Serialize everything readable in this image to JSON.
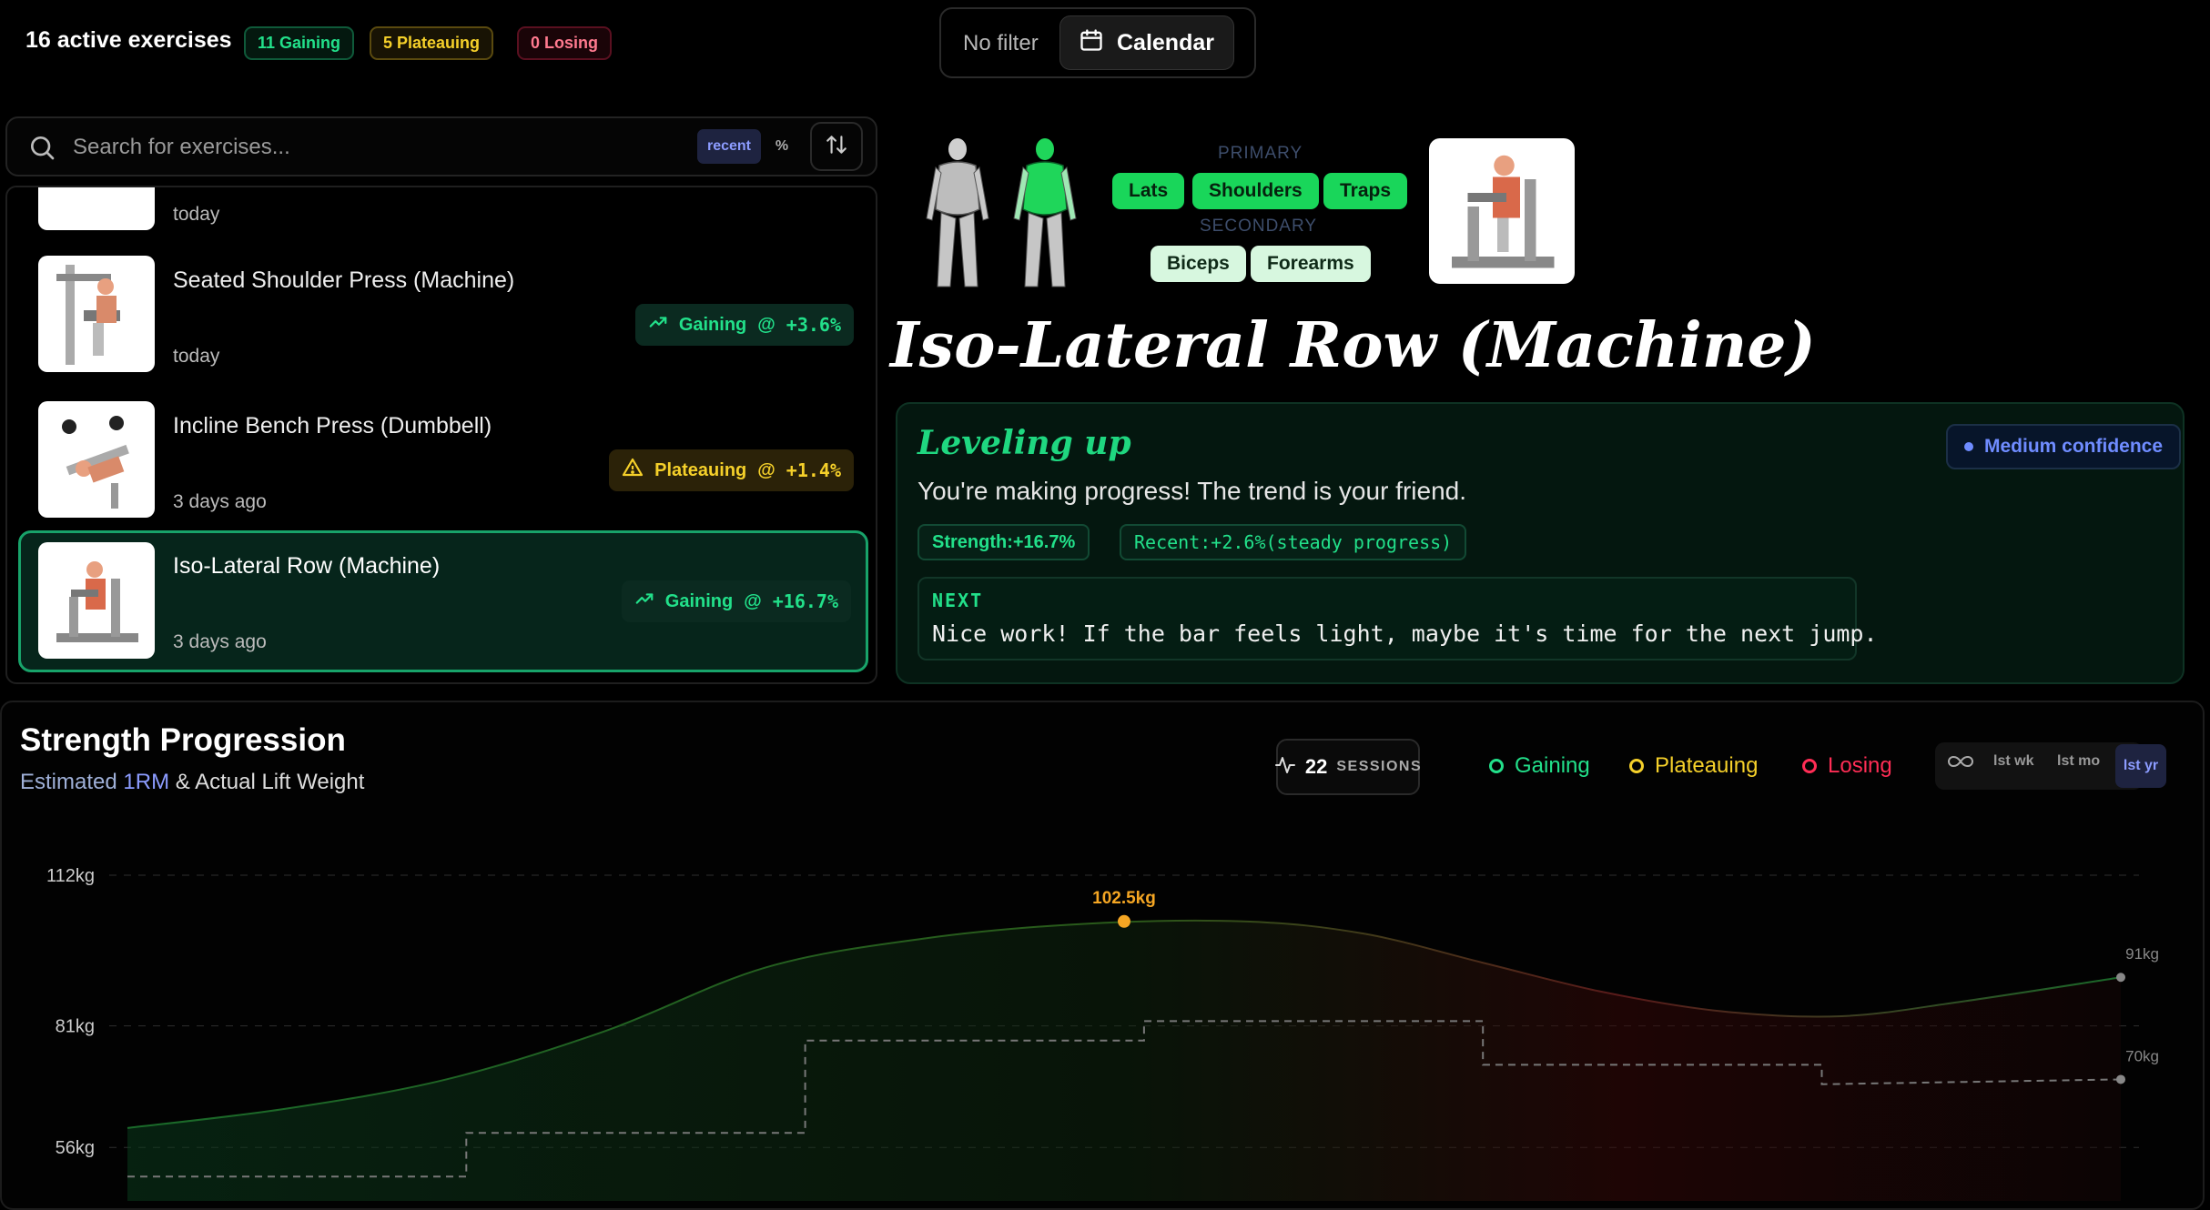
{
  "header": {
    "active_count": "16 active exercises",
    "badges": [
      {
        "label": "11 Gaining",
        "color": "#22e08a"
      },
      {
        "label": "5 Plateauing",
        "color": "#f5d02a"
      },
      {
        "label": "0 Losing",
        "color": "#ff4d6d"
      }
    ],
    "filter_label": "No filter",
    "calendar_label": "Calendar"
  },
  "search": {
    "placeholder": "Search for exercises...",
    "sort_recent": "recent",
    "sort_percent": "%"
  },
  "exercises": [
    {
      "name": "",
      "date": "today",
      "trend": "",
      "value": ""
    },
    {
      "name": "Seated Shoulder Press (Machine)",
      "date": "today",
      "trend": "Gaining",
      "at": "@",
      "value": "+3.6%"
    },
    {
      "name": "Incline Bench Press (Dumbbell)",
      "date": "3 days ago",
      "trend": "Plateauing",
      "at": "@",
      "value": "+1.4%"
    },
    {
      "name": "Iso-Lateral Row (Machine)",
      "date": "3 days ago",
      "trend": "Gaining",
      "at": "@",
      "value": "+16.7%"
    }
  ],
  "muscles": {
    "primary_label": "PRIMARY",
    "primary": [
      "Lats",
      "Shoulders",
      "Traps"
    ],
    "secondary_label": "SECONDARY",
    "secondary": [
      "Biceps",
      "Forearms"
    ]
  },
  "selected_exercise": "Iso-Lateral Row (Machine)",
  "insight": {
    "heading": "Leveling up",
    "confidence": "Medium confidence",
    "message": "You're making progress! The trend is your friend.",
    "stats": [
      "Strength:+16.7%",
      "Recent:+2.6%(steady progress)"
    ],
    "next_label": "NEXT",
    "next_text": "Nice work! If the bar feels light, maybe it's time for the next jump."
  },
  "chart_panel": {
    "title": "Strength Progression",
    "subtitle_prefix": "Estimated ",
    "subtitle_rm": "1RM",
    "subtitle_suffix": " & Actual Lift Weight",
    "sessions_count": "22",
    "sessions_label": "SESSIONS",
    "legend": [
      {
        "label": "Gaining",
        "color": "#22e08a"
      },
      {
        "label": "Plateauing",
        "color": "#f5d02a"
      },
      {
        "label": "Losing",
        "color": "#ff2d55"
      }
    ],
    "ranges": [
      "lst wk",
      "lst mo",
      "lst yr"
    ],
    "active_range": "lst yr"
  },
  "chart_data": {
    "type": "line",
    "ylabel": "",
    "ylim": [
      45,
      118
    ],
    "yticks": [
      {
        "value": 112,
        "label": "112kg"
      },
      {
        "value": 81,
        "label": "81kg"
      },
      {
        "value": 56,
        "label": "56kg"
      }
    ],
    "series": [
      {
        "name": "Estimated 1RM",
        "x": [
          0,
          0.08,
          0.16,
          0.24,
          0.32,
          0.4,
          0.48,
          0.56,
          0.62,
          0.68,
          0.74,
          0.8,
          0.86,
          0.92,
          1.0
        ],
        "values": [
          60,
          64,
          70,
          80,
          93,
          99,
          102,
          102.5,
          100,
          94,
          88,
          84,
          83,
          86,
          91
        ]
      },
      {
        "name": "Actual Lift Weight",
        "x": [
          0,
          0.17,
          0.17,
          0.34,
          0.34,
          0.51,
          0.51,
          0.68,
          0.68,
          0.85,
          0.85,
          1.0
        ],
        "values": [
          50,
          50,
          59,
          59,
          78,
          78,
          82,
          82,
          73,
          73,
          69,
          70
        ]
      }
    ],
    "annotations": [
      {
        "label": "102.5kg",
        "x": 0.5,
        "value": 102.5,
        "color": "#f5a623"
      },
      {
        "label": "91kg",
        "x": 1.0,
        "value": 91,
        "color": "#888"
      },
      {
        "label": "70kg",
        "x": 1.0,
        "value": 70,
        "color": "#888"
      }
    ]
  }
}
